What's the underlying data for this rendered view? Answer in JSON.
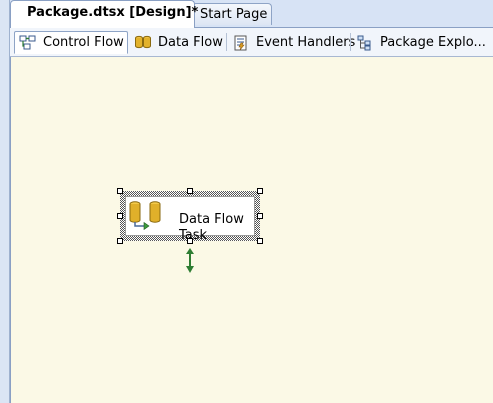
{
  "document_tabs": [
    {
      "label": "Package.dtsx [Design]*",
      "active": true
    },
    {
      "label": "Start Page",
      "active": false
    }
  ],
  "designer_tabs": [
    {
      "label": "Control Flow",
      "icon": "control-flow-icon",
      "active": true
    },
    {
      "label": "Data Flow",
      "icon": "data-flow-icon",
      "active": false
    },
    {
      "label": "Event Handlers",
      "icon": "event-handlers-icon",
      "active": false
    },
    {
      "label": "Package Explo...",
      "icon": "package-explorer-icon",
      "active": false
    }
  ],
  "canvas": {
    "background": "#fbf9e6",
    "tasks": [
      {
        "label_line1": "Data Flow",
        "label_line2": "Task",
        "icon": "data-flow-task-icon",
        "selected": true
      }
    ],
    "precedence_constraint_color": "#2e7d32"
  },
  "colors": {
    "chrome": "#d7e3f5",
    "tab_border": "#8aa0c4",
    "connector_green": "#2e7d32"
  }
}
